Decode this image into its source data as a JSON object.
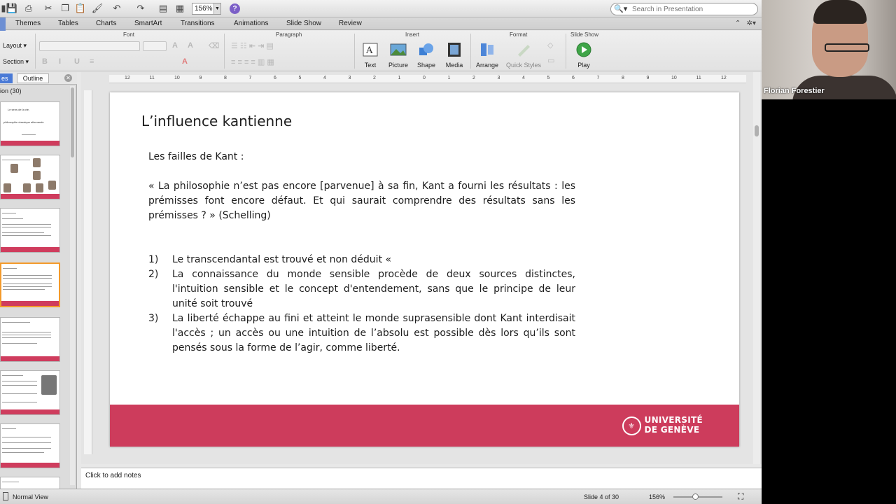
{
  "app": {
    "zoom": "156%",
    "search_placeholder": "Search in Presentation"
  },
  "tabs": [
    "Themes",
    "Tables",
    "Charts",
    "SmartArt",
    "Transitions",
    "Animations",
    "Slide Show",
    "Review"
  ],
  "ribbon": {
    "groups": {
      "font": "Font",
      "paragraph": "Paragraph",
      "insert": "Insert",
      "format": "Format",
      "slideshow": "Slide Show"
    },
    "layout": "Layout",
    "section": "Section",
    "buttons": {
      "text": "Text",
      "picture": "Picture",
      "shape": "Shape",
      "media": "Media",
      "arrange": "Arrange",
      "quick_styles": "Quick Styles",
      "play": "Play"
    }
  },
  "left_panel": {
    "slides_tab": "es",
    "outline_tab": "Outline",
    "section_label": "ion (30)",
    "thumb1_line1": "Le sens de la vie,",
    "thumb1_line2": "philosophie classique allemande"
  },
  "slide": {
    "title": "L’influence kantienne",
    "subtitle": "Les failles de Kant :",
    "quote": "« La philosophie n’est pas encore [parvenue] à sa fin, Kant a fourni les résultats : les prémisses font encore défaut. Et qui saurait comprendre des résultats sans les prémisses ? » (Schelling)",
    "items": [
      {
        "num": "1)",
        "text": "Le transcendantal est trouvé et non déduit «"
      },
      {
        "num": "2)",
        "text": "La connaissance du monde sensible procède de deux sources distinctes, l'intuition sensible et le concept d'entendement, sans que le principe de leur unité soit trouvé"
      },
      {
        "num": "3)",
        "text": "La liberté échappe au fini et atteint le monde suprasensible dont Kant interdisait l'accès ; un accès ou une intuition de l’absolu est possible dès lors qu’ils sont pensés sous la forme de l’agir, comme liberté."
      }
    ],
    "logo_line1": "UNIVERSITÉ",
    "logo_line2": "DE GENÈVE",
    "footer_color": "#cd3c5c"
  },
  "notes_placeholder": "Click to add notes",
  "status": {
    "view": "Normal View",
    "slide_info": "Slide 4 of 30",
    "zoom": "156%"
  },
  "webcam": {
    "name": "Florian Forestier"
  },
  "colors": {
    "accent": "#cd3c5c",
    "selection": "#f39a2b",
    "active_tab": "#6d8fd3"
  }
}
